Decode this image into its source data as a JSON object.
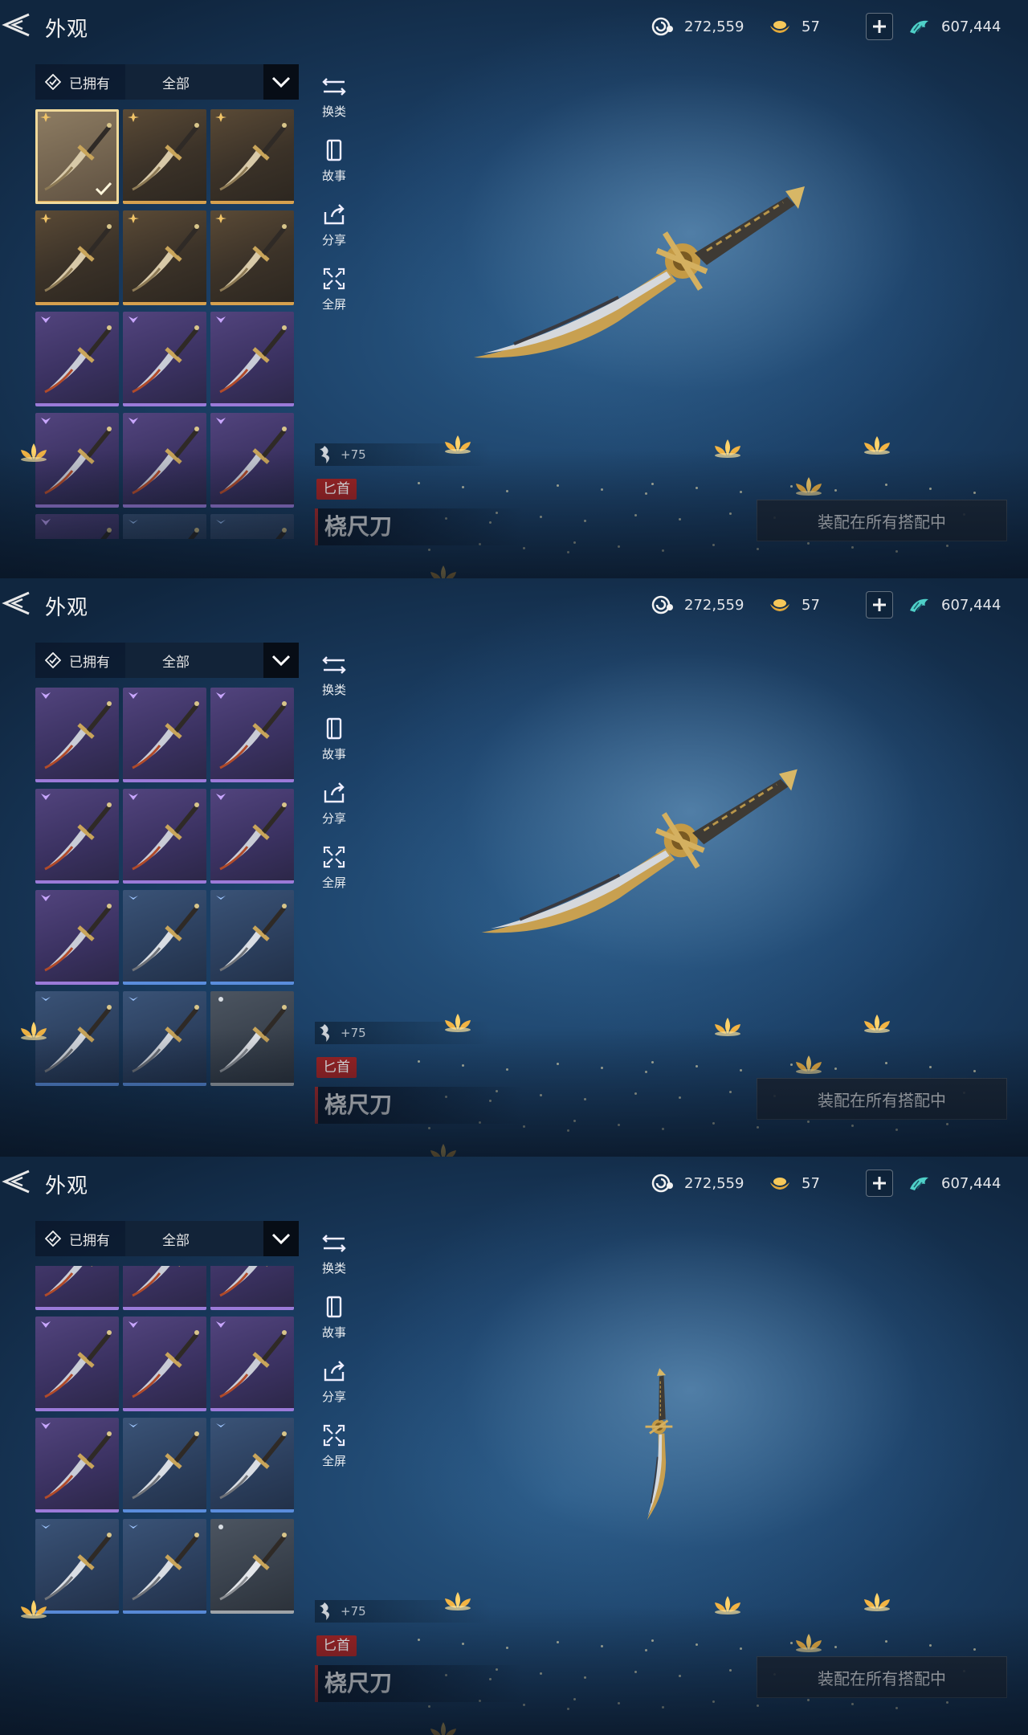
{
  "header": {
    "title": "外观",
    "currencies": [
      {
        "icon": "spiral-token-icon",
        "value": "272,559"
      },
      {
        "icon": "gold-ingot-icon",
        "value": "57"
      },
      {
        "icon": "jade-fish-icon",
        "value": "607,444"
      }
    ]
  },
  "filter": {
    "owned_label": "已拥有",
    "selected_option": "全部"
  },
  "tools": [
    {
      "icon": "swap-weapon-icon",
      "label": "换类"
    },
    {
      "icon": "story-book-icon",
      "label": "故事"
    },
    {
      "icon": "share-icon",
      "label": "分享"
    },
    {
      "icon": "fullscreen-icon",
      "label": "全屏"
    }
  ],
  "item": {
    "level": "+75",
    "type_badge": "匕首",
    "name": "桡尺刀"
  },
  "equip_button_label": "装配在所有搭配中",
  "colors": {
    "accent_red": "#a82424",
    "gold_rarity": "#d6a04e",
    "purple_rarity": "#9b7ad8",
    "blue_rarity": "#5a8ddc"
  },
  "grid_items": [
    {
      "rarity": "gold",
      "selected": true,
      "equipped": true
    },
    {
      "rarity": "gold"
    },
    {
      "rarity": "gold"
    },
    {
      "rarity": "gold"
    },
    {
      "rarity": "gold"
    },
    {
      "rarity": "gold"
    },
    {
      "rarity": "purple"
    },
    {
      "rarity": "purple"
    },
    {
      "rarity": "purple"
    },
    {
      "rarity": "purple"
    },
    {
      "rarity": "purple"
    },
    {
      "rarity": "purple"
    },
    {
      "rarity": "purple"
    },
    {
      "rarity": "blue"
    },
    {
      "rarity": "blue"
    },
    {
      "rarity": "blue"
    },
    {
      "rarity": "blue"
    },
    {
      "rarity": "grey"
    }
  ],
  "screens": [
    {
      "scroll_row": 0
    },
    {
      "scroll_row": 2
    },
    {
      "scroll_row": 2.5
    }
  ]
}
